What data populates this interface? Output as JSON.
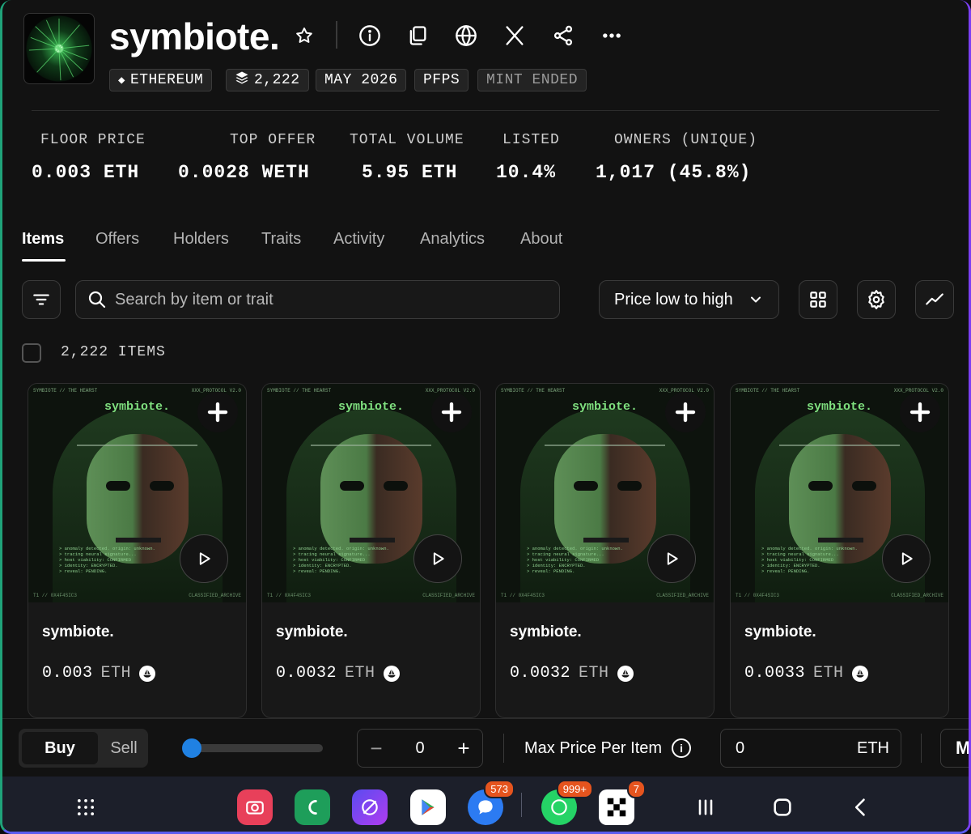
{
  "collection": {
    "title": "symbiote.",
    "tags": [
      {
        "label": "ETHEREUM",
        "icon": "ethereum-icon"
      },
      {
        "label": "2,222",
        "icon": "layers-icon"
      },
      {
        "label": "MAY 2026"
      },
      {
        "label": "PFPS"
      },
      {
        "label": "MINT ENDED"
      }
    ]
  },
  "stats": [
    {
      "label": "FLOOR PRICE",
      "value": "0.003 ETH"
    },
    {
      "label": "TOP OFFER",
      "value": "0.0028 WETH"
    },
    {
      "label": "TOTAL VOLUME",
      "value": "5.95 ETH"
    },
    {
      "label": "LISTED",
      "value": "10.4%"
    },
    {
      "label": "OWNERS (UNIQUE)",
      "value": "1,017 (45.8%)"
    }
  ],
  "tabs": [
    "Items",
    "Offers",
    "Holders",
    "Traits",
    "Activity",
    "Analytics",
    "About"
  ],
  "toolbar": {
    "search_placeholder": "Search by item or trait",
    "sort_label": "Price low to high"
  },
  "item_count": "2,222 ITEMS",
  "artwork": {
    "wordmark": "symbiote.",
    "top_left": "SYMBIOTE // THE HEARST",
    "top_right": "XXX_PROTOCOL V2.0",
    "terminal": [
      "> anomaly detected. origin: unknown.",
      "> tracing neural signature...",
      "> host viability: CONFIRMED",
      "> identity: ENCRYPTED.",
      "> reveal: PENDING."
    ],
    "foot_left": "T1 // 0X4F4SIC3",
    "foot_right": "CLASSIFIED_ARCHIVE"
  },
  "items": [
    {
      "name": "symbiote.",
      "price": "0.003",
      "currency": "ETH"
    },
    {
      "name": "symbiote.",
      "price": "0.0032",
      "currency": "ETH"
    },
    {
      "name": "symbiote.",
      "price": "0.0032",
      "currency": "ETH"
    },
    {
      "name": "symbiote.",
      "price": "0.0033",
      "currency": "ETH"
    }
  ],
  "buybar": {
    "buy_label": "Buy",
    "sell_label": "Sell",
    "sweep_fraction": 0,
    "quantity": "0",
    "minus": "−",
    "plus": "+",
    "max_price_label": "Max Price Per Item",
    "info": "i",
    "max_price_value": "0",
    "max_price_currency": "ETH",
    "more_label": "M"
  },
  "taskbar": {
    "apps": [
      {
        "name": "apps-grid-icon"
      },
      {
        "name": "camera-app-icon",
        "color": "#e8405a"
      },
      {
        "name": "phone-app-icon",
        "color": "#1e9e5a"
      },
      {
        "name": "browser-app-icon",
        "color": "#7a3cf0"
      },
      {
        "name": "play-store-icon",
        "color": "#ffffff"
      },
      {
        "name": "messages-app-icon",
        "color": "#2c7bf2",
        "badge": "573"
      },
      {
        "name": "whatsapp-icon",
        "color": "#25d366",
        "badge": "999+"
      },
      {
        "name": "okx-app-icon",
        "color": "#ffffff",
        "badge": "7"
      }
    ]
  },
  "colors": {
    "accent": "#2081e2",
    "badge": "#e5541e",
    "background": "#121212"
  }
}
